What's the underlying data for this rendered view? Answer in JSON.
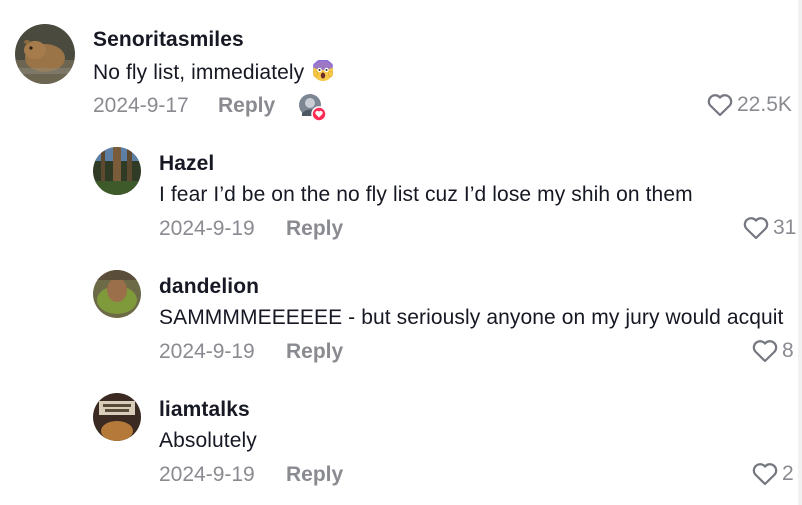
{
  "comments": [
    {
      "username": "Senoritasmiles",
      "text": "No fly list, immediately",
      "emoji": "screaming-face-emoji",
      "date": "2024-9-17",
      "reply_label": "Reply",
      "likes": "22.5K",
      "liked_by_creator": true
    },
    {
      "username": "Hazel",
      "text": "I fear I’d be on the no fly list cuz I’d lose my shih on them",
      "date": "2024-9-19",
      "reply_label": "Reply",
      "likes": "31"
    },
    {
      "username": "dandelion",
      "text": "SAMMMMEEEEEE - but seriously anyone on my jury would acquit",
      "date": "2024-9-19",
      "reply_label": "Reply",
      "likes": "8"
    },
    {
      "username": "liamtalks",
      "text": "Absolutely",
      "date": "2024-9-19",
      "reply_label": "Reply",
      "likes": "2"
    }
  ],
  "icons": {
    "like": "heart-outline-icon",
    "creator_like_badge": "red-heart-badge-icon"
  },
  "colors": {
    "text_primary": "#161823",
    "text_secondary": "#8a8b91",
    "badge_red": "#fe2c55"
  }
}
